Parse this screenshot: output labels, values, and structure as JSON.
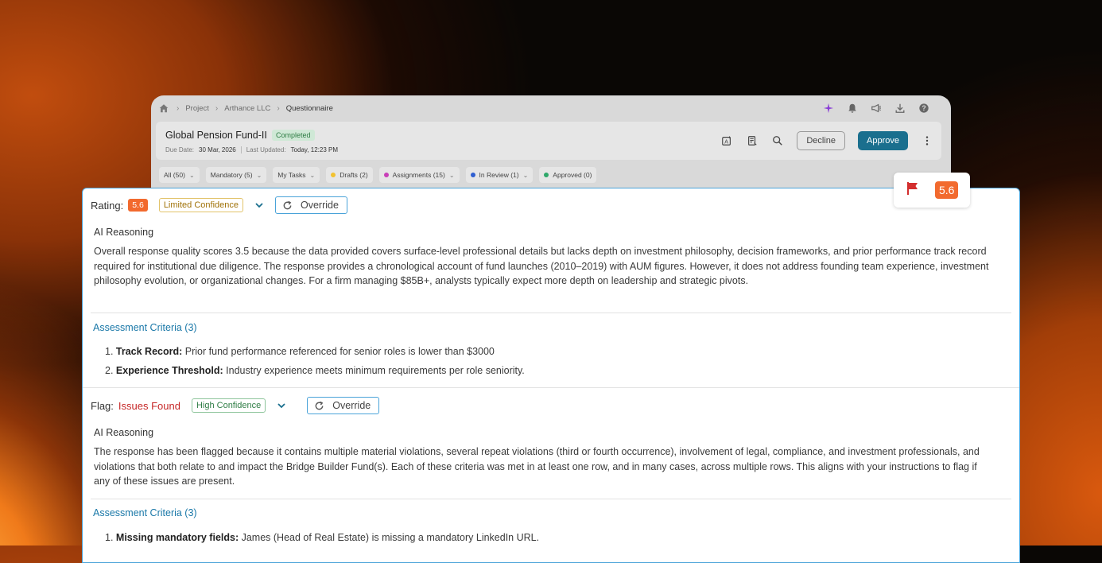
{
  "breadcrumb": {
    "items": [
      "Project",
      "Arthance LLC",
      "Questionnaire"
    ]
  },
  "top_icons": [
    "sparkle-icon",
    "bell-icon",
    "megaphone-icon",
    "download-icon",
    "help-icon"
  ],
  "header": {
    "title": "Global Pension Fund-II",
    "status": "Completed",
    "due_label": "Due Date:",
    "due_value": "30 Mar, 2026",
    "updated_label": "Last Updated:",
    "updated_value": "Today, 12:23 PM",
    "decline_label": "Decline",
    "approve_label": "Approve"
  },
  "filters": [
    {
      "label": "All (50)"
    },
    {
      "label": "Mandatory (5)"
    },
    {
      "label": "My Tasks"
    },
    {
      "label": "Drafts (2)",
      "color": "#f2c230"
    },
    {
      "label": "Assignments (15)",
      "color": "#c93fb8"
    },
    {
      "label": "In Review (1)",
      "color": "#2f5fd1"
    },
    {
      "label": "Approved (0)",
      "color": "#2ea86a"
    }
  ],
  "rating": {
    "label": "Rating:",
    "score": "5.6",
    "confidence": "Limited Confidence",
    "override_label": "Override",
    "reasoning_title": "AI Reasoning",
    "reasoning_text": "Overall response quality scores 3.5 because the data provided covers surface-level professional details but lacks depth on investment philosophy, decision frameworks, and prior performance track record required for institutional due diligence. The response provides a chronological account of fund launches (2010–2019) with AUM figures. However, it does not address founding team experience, investment philosophy evolution, or organizational changes. For a firm managing $85B+, analysts typically expect more depth on leadership and strategic pivots.",
    "criteria_title": "Assessment Criteria (3)",
    "criteria": [
      {
        "num": "1.",
        "title": "Track Record:",
        "text": "Prior fund performance referenced for senior roles is lower than $3000"
      },
      {
        "num": "2.",
        "title": "Experience Threshold:",
        "text": "Industry experience meets minimum requirements per role seniority."
      }
    ]
  },
  "flag": {
    "label": "Flag:",
    "status": "Issues Found",
    "confidence": "High Confidence",
    "override_label": "Override",
    "reasoning_title": "AI Reasoning",
    "reasoning_text": "The response has been flagged because it contains multiple material violations, several repeat violations (third or fourth occurrence), involvement of legal, compliance, and investment professionals, and violations that both relate to and impact the Bridge Builder Fund(s). Each of these criteria was met in at least one row, and in many cases, across multiple rows. This aligns with your instructions to flag if any of these issues are present.",
    "criteria_title": "Assessment Criteria (3)",
    "criteria": [
      {
        "num": "1.",
        "title": "Missing mandatory fields:",
        "text": "James (Head of Real Estate) is missing a mandatory LinkedIn URL."
      }
    ]
  },
  "floating_badge": {
    "score": "5.6"
  }
}
